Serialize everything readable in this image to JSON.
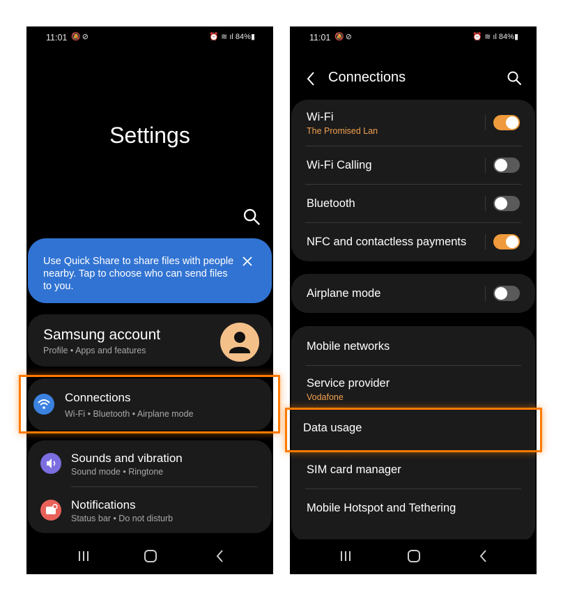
{
  "left": {
    "status": {
      "time": "11:01",
      "battery": "84%"
    },
    "title": "Settings",
    "quick_share": {
      "text": "Use Quick Share to share files with people nearby. Tap to choose who can send files to you."
    },
    "account": {
      "title": "Samsung account",
      "subtitle": "Profile  •  Apps and features"
    },
    "connections": {
      "title": "Connections",
      "subtitle": "Wi-Fi  •  Bluetooth  •  Airplane mode",
      "icon": "wifi-icon",
      "color": "#3b82e0"
    },
    "sounds": {
      "title": "Sounds and vibration",
      "subtitle": "Sound mode  •  Ringtone",
      "icon": "volume-icon",
      "color": "#7b6ee0"
    },
    "notifications": {
      "title": "Notifications",
      "subtitle": "Status bar  •  Do not disturb",
      "icon": "notification-icon",
      "color": "#e8625a"
    }
  },
  "right": {
    "status": {
      "time": "11:01",
      "battery": "84%"
    },
    "header": {
      "title": "Connections"
    },
    "wifi": {
      "title": "Wi-Fi",
      "subtitle": "The Promised Lan",
      "on": true
    },
    "wifi_calling": {
      "title": "Wi-Fi Calling",
      "on": false
    },
    "bluetooth": {
      "title": "Bluetooth",
      "on": false
    },
    "nfc": {
      "title": "NFC and contactless payments",
      "on": true
    },
    "airplane": {
      "title": "Airplane mode",
      "on": false
    },
    "mobile_networks": {
      "title": "Mobile networks"
    },
    "service_provider": {
      "title": "Service provider",
      "subtitle": "Vodafone"
    },
    "data_usage": {
      "title": "Data usage"
    },
    "sim_manager": {
      "title": "SIM card manager"
    },
    "hotspot": {
      "title": "Mobile Hotspot and Tethering"
    }
  },
  "colors": {
    "highlight": "#ff7a00",
    "accent": "#ef9a3c",
    "banner": "#3173d2"
  }
}
